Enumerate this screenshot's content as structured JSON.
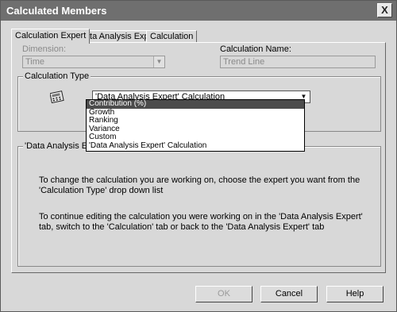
{
  "window": {
    "title": "Calculated Members",
    "close_glyph": "X"
  },
  "tabs": [
    {
      "label": "Calculation Expert",
      "active": true
    },
    {
      "label": "Data Analysis Expert",
      "active": false
    },
    {
      "label": "Calculation",
      "active": false
    }
  ],
  "dimension": {
    "label": "Dimension:",
    "value": "Time"
  },
  "calc_name": {
    "label": "Calculation Name:",
    "value": "Trend Line"
  },
  "calc_type": {
    "group_label": "Calculation Type",
    "selected": "'Data Analysis Expert' Calculation",
    "options": [
      "Contribution (%)",
      "Growth",
      "Ranking",
      "Variance",
      "Custom",
      "'Data Analysis Expert' Calculation"
    ],
    "highlighted_index": 0
  },
  "expert_group": {
    "label": "'Data Analysis Expert",
    "info1": "To change the calculation you are working on, choose the expert you want from the 'Calculation Type' drop down list",
    "info2": "To continue editing the calculation you were working on in the 'Data Analysis Expert' tab, switch to the 'Calculation' tab or back to the 'Data Analysis Expert' tab"
  },
  "buttons": {
    "ok": "OK",
    "cancel": "Cancel",
    "help": "Help"
  }
}
